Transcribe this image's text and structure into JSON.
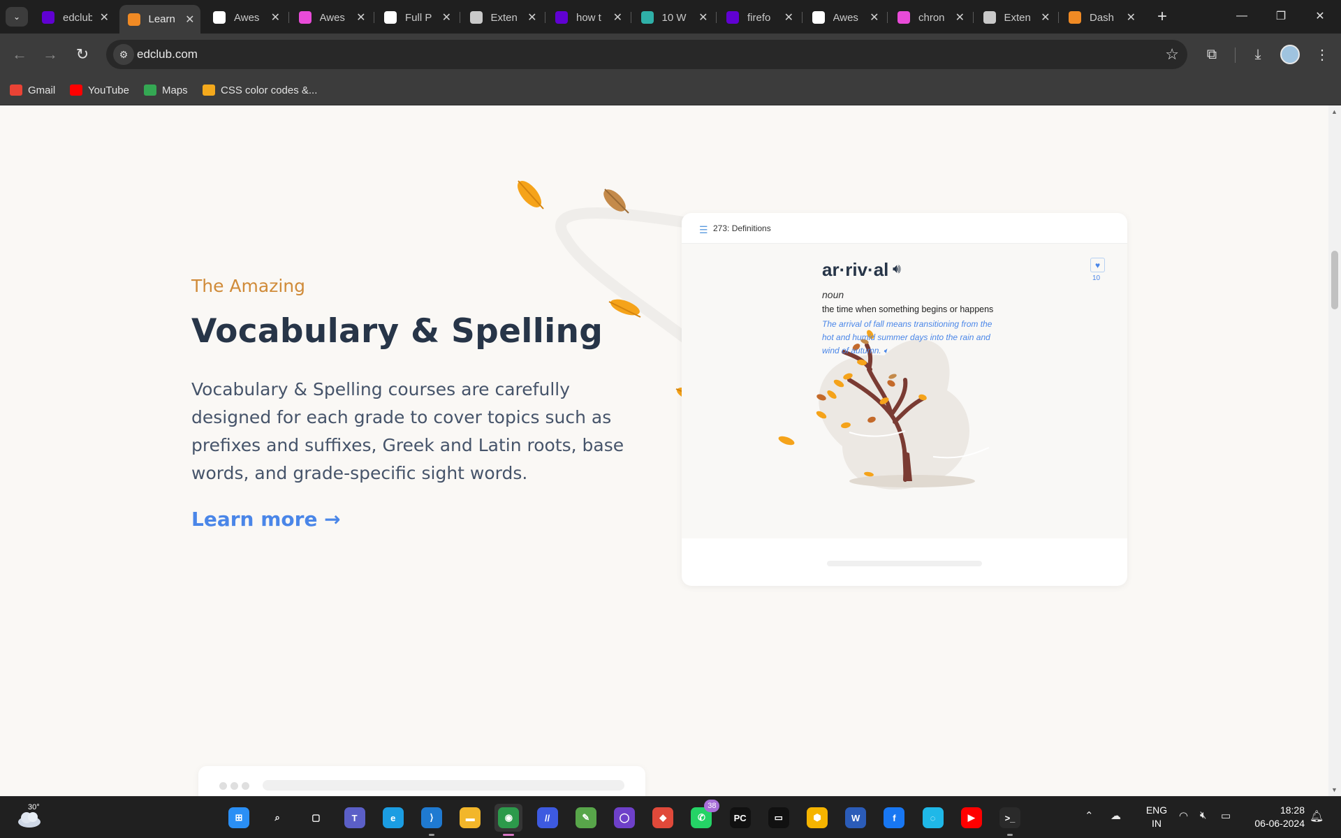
{
  "browser": {
    "tabs": [
      {
        "label": "edclub",
        "favicon": "yahoo-icon",
        "color": "#6001d2",
        "active": false
      },
      {
        "label": "Learn",
        "favicon": "edclub-hand-icon",
        "color": "#f08a24",
        "active": true
      },
      {
        "label": "Awes",
        "favicon": "rainbow-icon",
        "color": "#ffffff",
        "active": false
      },
      {
        "label": "Awes",
        "favicon": "colorwheel-icon",
        "color": "#e84bd8",
        "active": false
      },
      {
        "label": "Full P",
        "favicon": "rainbow-icon",
        "color": "#ffffff",
        "active": false
      },
      {
        "label": "Exten",
        "favicon": "puzzle-icon",
        "color": "#c9c9c9",
        "active": false
      },
      {
        "label": "how t",
        "favicon": "yahoo-icon",
        "color": "#6001d2",
        "active": false
      },
      {
        "label": "10 W",
        "favicon": "stackshare-icon",
        "color": "#2fb0a8",
        "active": false
      },
      {
        "label": "firefo",
        "favicon": "yahoo-icon",
        "color": "#6001d2",
        "active": false
      },
      {
        "label": "Awes",
        "favicon": "rainbow-icon",
        "color": "#ffffff",
        "active": false
      },
      {
        "label": "chron",
        "favicon": "colorwheel-icon",
        "color": "#e84bd8",
        "active": false
      },
      {
        "label": "Exten",
        "favicon": "puzzle-icon",
        "color": "#c9c9c9",
        "active": false
      },
      {
        "label": "Dash",
        "favicon": "edclub-hand-icon",
        "color": "#f08a24",
        "active": false
      }
    ],
    "url": "edclub.com",
    "bookmarks": [
      {
        "label": "Gmail",
        "icon": "gmail-icon",
        "color": "#ea4335"
      },
      {
        "label": "YouTube",
        "icon": "youtube-icon",
        "color": "#ff0000"
      },
      {
        "label": "Maps",
        "icon": "maps-icon",
        "color": "#34a853"
      },
      {
        "label": "CSS color codes &...",
        "icon": "r-logo-icon",
        "color": "#f4a91c"
      }
    ]
  },
  "content": {
    "kicker": "The Amazing",
    "heading": "Vocabulary & Spelling",
    "description": "Vocabulary & Spelling courses are carefully designed for each grade to cover topics such as prefixes and suffixes, Greek and Latin roots, base words, and grade-specific sight words.",
    "learn_more": "Learn more →",
    "card": {
      "title": "273: Definitions",
      "word": "ar·riv·al",
      "part_of_speech": "noun",
      "definition": "the time when something begins or happens",
      "example": "The arrival of fall means transitioning from the hot and humid summer days into the rain and wind of autumn.",
      "heart_count": "10"
    }
  },
  "colors": {
    "kicker": "#d08b39",
    "heading": "#273548",
    "link": "#4a86e8",
    "leaf": "#f5a31a",
    "trunk": "#7a3b33"
  },
  "taskbar": {
    "weather_temp": "30°",
    "apps": [
      {
        "name": "start-icon",
        "label": "⊞",
        "color": "#2a8ff5"
      },
      {
        "name": "search-icon",
        "label": "⌕",
        "color": "#202020"
      },
      {
        "name": "task-view-icon",
        "label": "▢",
        "color": "#202020"
      },
      {
        "name": "teams-icon",
        "label": "T",
        "color": "#5b5fc7"
      },
      {
        "name": "edge-icon",
        "label": "e",
        "color": "#1b9de2"
      },
      {
        "name": "vscode-icon",
        "label": "⟩",
        "color": "#1f7ad1"
      },
      {
        "name": "file-explorer-icon",
        "label": "▬",
        "color": "#f2b62a"
      },
      {
        "name": "chrome-icon",
        "label": "◉",
        "color": "#2c9a4b"
      },
      {
        "name": "ide-icon",
        "label": "//",
        "color": "#3d5ae0"
      },
      {
        "name": "notepad-icon",
        "label": "✎",
        "color": "#58a64a"
      },
      {
        "name": "github-icon",
        "label": "◯",
        "color": "#6e40c9"
      },
      {
        "name": "git-icon",
        "label": "◆",
        "color": "#e0493a"
      },
      {
        "name": "whatsapp-icon",
        "label": "✆",
        "color": "#25d366",
        "badge": "38"
      },
      {
        "name": "pycharm-icon",
        "label": "PC",
        "color": "#111111"
      },
      {
        "name": "terminal-icon",
        "label": "▭",
        "color": "#111111"
      },
      {
        "name": "box-icon",
        "label": "⬢",
        "color": "#f5b400"
      },
      {
        "name": "word-icon",
        "label": "W",
        "color": "#2b5cb8"
      },
      {
        "name": "facebook-icon",
        "label": "f",
        "color": "#1877f2"
      },
      {
        "name": "alexa-icon",
        "label": "◌",
        "color": "#1fb8e8"
      },
      {
        "name": "youtube-app-icon",
        "label": "▶",
        "color": "#ff0000"
      },
      {
        "name": "windows-terminal-icon",
        "label": ">_",
        "color": "#2a2a2a"
      }
    ],
    "lang_line1": "ENG",
    "lang_line2": "IN",
    "time": "18:28",
    "date": "06-06-2024"
  }
}
